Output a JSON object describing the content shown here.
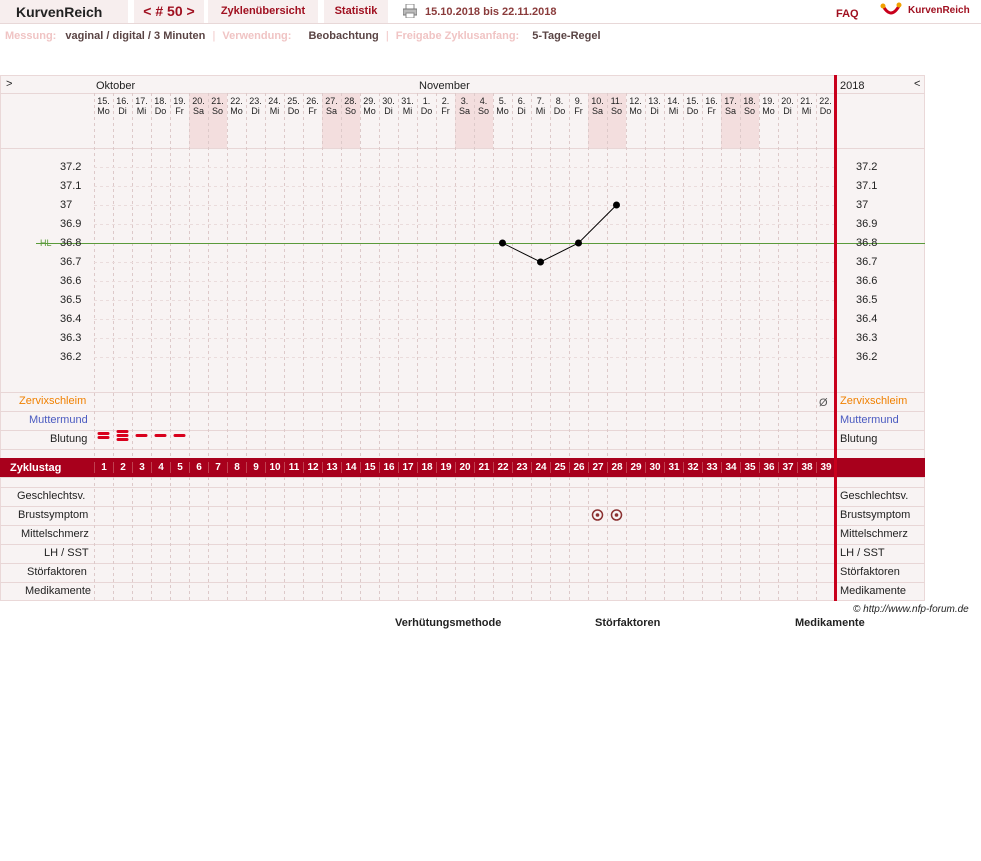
{
  "header": {
    "brand": "KurvenReich",
    "cycle_nav": "< # 50 >",
    "tab_overview": "Zyklenübersicht",
    "tab_stats": "Statistik",
    "date_range": "15.10.2018 bis 22.11.2018",
    "faq": "FAQ",
    "logo_text": "KurvenReich"
  },
  "meta": {
    "measure_label": "Messung:",
    "measure_value": "vaginal / digital / 3 Minuten",
    "use_label": "Verwendung:",
    "use_value": "Beobachtung",
    "start_label": "Freigabe Zyklusanfang:",
    "start_value": "5-Tage-Regel"
  },
  "calendar": {
    "nav_left": ">",
    "nav_right": "<",
    "month_october": "Oktober",
    "month_november": "November",
    "year": "2018",
    "days": [
      {
        "d": "15.",
        "w": "Mo"
      },
      {
        "d": "16.",
        "w": "Di"
      },
      {
        "d": "17.",
        "w": "Mi"
      },
      {
        "d": "18.",
        "w": "Do"
      },
      {
        "d": "19.",
        "w": "Fr"
      },
      {
        "d": "20.",
        "w": "Sa"
      },
      {
        "d": "21.",
        "w": "So"
      },
      {
        "d": "22.",
        "w": "Mo"
      },
      {
        "d": "23.",
        "w": "Di"
      },
      {
        "d": "24.",
        "w": "Mi"
      },
      {
        "d": "25.",
        "w": "Do"
      },
      {
        "d": "26.",
        "w": "Fr"
      },
      {
        "d": "27.",
        "w": "Sa"
      },
      {
        "d": "28.",
        "w": "So"
      },
      {
        "d": "29.",
        "w": "Mo"
      },
      {
        "d": "30.",
        "w": "Di"
      },
      {
        "d": "31.",
        "w": "Mi"
      },
      {
        "d": "1.",
        "w": "Do"
      },
      {
        "d": "2.",
        "w": "Fr"
      },
      {
        "d": "3.",
        "w": "Sa"
      },
      {
        "d": "4.",
        "w": "So"
      },
      {
        "d": "5.",
        "w": "Mo"
      },
      {
        "d": "6.",
        "w": "Di"
      },
      {
        "d": "7.",
        "w": "Mi"
      },
      {
        "d": "8.",
        "w": "Do"
      },
      {
        "d": "9.",
        "w": "Fr"
      },
      {
        "d": "10.",
        "w": "Sa"
      },
      {
        "d": "11.",
        "w": "So"
      },
      {
        "d": "12.",
        "w": "Mo"
      },
      {
        "d": "13.",
        "w": "Di"
      },
      {
        "d": "14.",
        "w": "Mi"
      },
      {
        "d": "15.",
        "w": "Do"
      },
      {
        "d": "16.",
        "w": "Fr"
      },
      {
        "d": "17.",
        "w": "Sa"
      },
      {
        "d": "18.",
        "w": "So"
      },
      {
        "d": "19.",
        "w": "Mo"
      },
      {
        "d": "20.",
        "w": "Di"
      },
      {
        "d": "21.",
        "w": "Mi"
      },
      {
        "d": "22.",
        "w": "Do"
      }
    ]
  },
  "chart_data": {
    "type": "line",
    "x_cycle_days": [
      22,
      24,
      26,
      28
    ],
    "y": [
      36.8,
      36.7,
      36.8,
      37.0
    ],
    "ylim": [
      36.2,
      37.2
    ],
    "yticks": [
      "37.2",
      "37.1",
      "37",
      "36.9",
      "36.8",
      "36.7",
      "36.6",
      "36.5",
      "36.4",
      "36.3",
      "36.2"
    ],
    "hl_label": "HL",
    "hl_value": 36.8,
    "cycle_days": [
      "1",
      "2",
      "3",
      "4",
      "5",
      "6",
      "7",
      "8",
      "9",
      "10",
      "11",
      "12",
      "13",
      "14",
      "15",
      "16",
      "17",
      "18",
      "19",
      "20",
      "21",
      "22",
      "23",
      "24",
      "25",
      "26",
      "27",
      "28",
      "29",
      "30",
      "31",
      "32",
      "33",
      "34",
      "35",
      "36",
      "37",
      "38",
      "39"
    ]
  },
  "rows": {
    "cervix": "Zervixschleim",
    "cervix_mark": "Ø",
    "muttermund": "Muttermund",
    "blutung": "Blutung",
    "zyklustag": "Zyklustag",
    "sex": "Geschlechtsv.",
    "brust": "Brustsymptom",
    "mittel": "Mittelschmerz",
    "lh": "LH / SST",
    "stoer": "Störfaktoren",
    "medi": "Medikamente"
  },
  "colors": {
    "cervix": "#f08000",
    "muttermund": "#4a5ac0",
    "accent": "#a8001c",
    "hl_line": "#5a9a3a"
  },
  "footer": {
    "copyright": "© http://www.nfp-forum.de",
    "contraception": "Verhütungsmethode",
    "disturb": "Störfaktoren",
    "medication": "Medikamente"
  }
}
